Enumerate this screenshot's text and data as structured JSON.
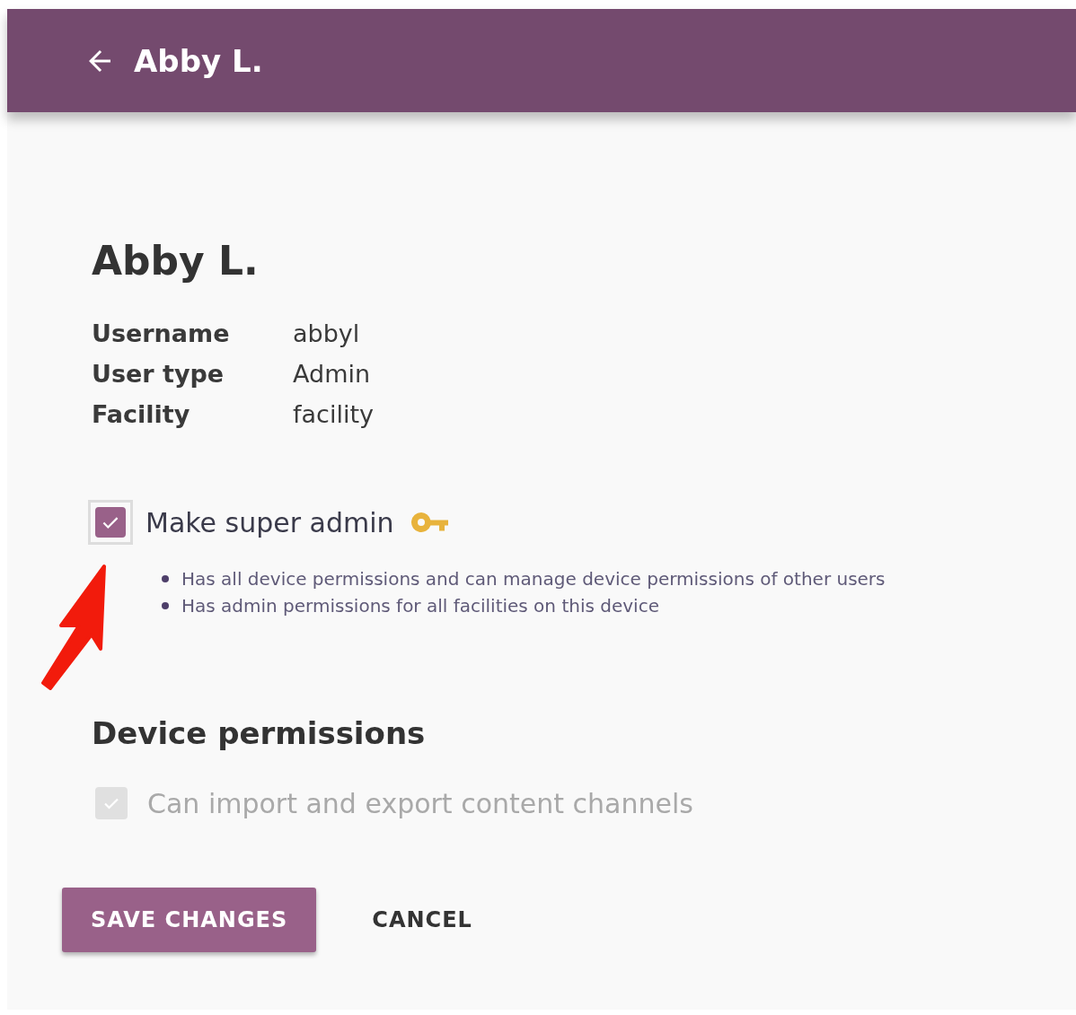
{
  "app_bar": {
    "title": "Abby L."
  },
  "user": {
    "name": "Abby L.",
    "details": [
      {
        "label": "Username",
        "value": "abbyl"
      },
      {
        "label": "User type",
        "value": "Admin"
      },
      {
        "label": "Facility",
        "value": "facility"
      }
    ]
  },
  "super_admin": {
    "label": "Make super admin",
    "checked": true,
    "disabled": false,
    "notes": [
      "Has all device permissions and can manage device permissions of other users",
      "Has admin permissions for all facilities on this device"
    ]
  },
  "device_permissions": {
    "heading": "Device permissions",
    "options": [
      {
        "label": "Can import and export content channels",
        "checked": true,
        "disabled": true
      }
    ]
  },
  "buttons": [
    {
      "label": "SAVE CHANGES",
      "kind": "primary"
    },
    {
      "label": "CANCEL",
      "kind": "flat"
    }
  ]
}
